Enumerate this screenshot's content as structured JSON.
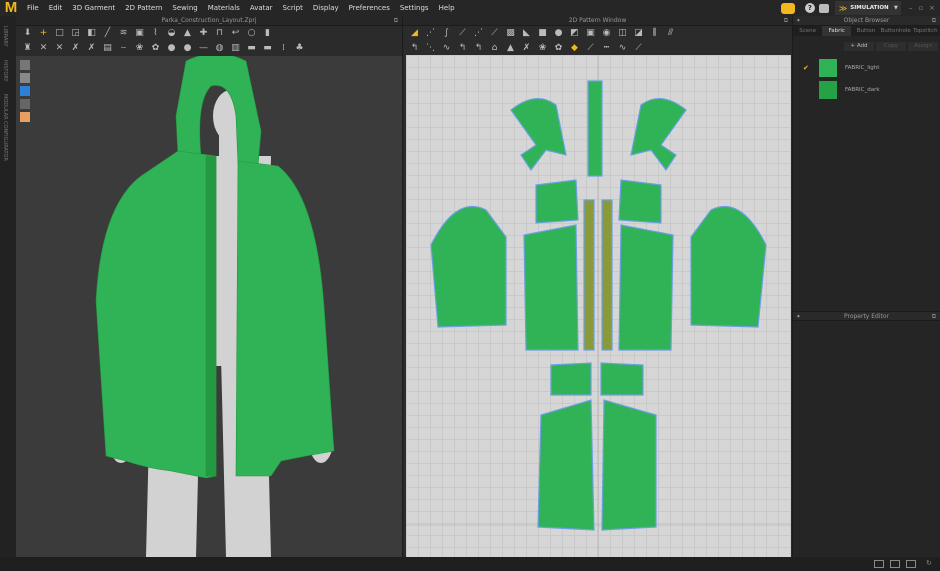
{
  "menu": [
    "File",
    "Edit",
    "3D Garment",
    "2D Pattern",
    "Sewing",
    "Materials",
    "Avatar",
    "Script",
    "Display",
    "Preferences",
    "Settings",
    "Help"
  ],
  "logo": "M",
  "side_labels": [
    "LIBRARY",
    "HISTORY",
    "MODULAR CONFIGURATOR"
  ],
  "window3d": {
    "title": "Parka_Construction_Layout.Zprj"
  },
  "window2d": {
    "title": "2D Pattern Window"
  },
  "top_right": {
    "mode": "SIMULATION",
    "help": "?"
  },
  "object_browser": {
    "title": "Object Browser",
    "tabs": [
      "Scene",
      "Fabric",
      "Button",
      "Buttonhole",
      "Topstitch"
    ],
    "active_tab": "Fabric",
    "buttons": [
      "+ Add",
      "Copy",
      "Assign"
    ],
    "fabrics": [
      {
        "name": "FABRIC_light",
        "color": "#2fb356",
        "selected": true
      },
      {
        "name": "FABRIC_dark",
        "color": "#25a246",
        "selected": false
      }
    ]
  },
  "property_editor": {
    "title": "Property Editor"
  },
  "colors": {
    "accent": "#f2b81c",
    "garment": "#2fb356",
    "outline": "#6aa0e0"
  }
}
